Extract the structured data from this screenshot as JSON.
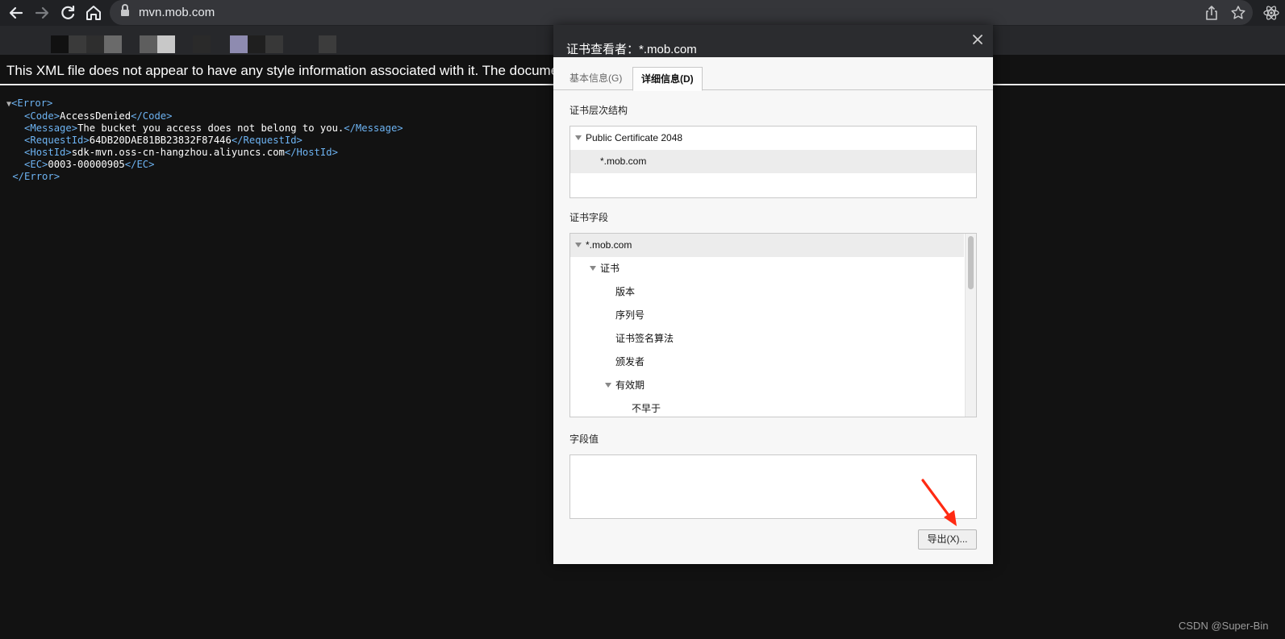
{
  "browser": {
    "url": "mvn.mob.com",
    "nav": [
      "back-icon",
      "forward-icon",
      "reload-icon",
      "home-icon"
    ],
    "omnibox_icons": [
      "share-icon",
      "star-icon"
    ],
    "extension_icon": "react-icon"
  },
  "page": {
    "xml_notice": "This XML file does not appear to have any style information associated with it. The docume",
    "xml": {
      "root_open": "<Error>",
      "root_close": "</Error>",
      "lines": [
        {
          "open": "<Code>",
          "value": "AccessDenied",
          "close": "</Code>"
        },
        {
          "open": "<Message>",
          "value": "The bucket you access does not belong to you.",
          "close": "</Message>"
        },
        {
          "open": "<RequestId>",
          "value": "64DB20DAE81BB23832F87446",
          "close": "</RequestId>"
        },
        {
          "open": "<HostId>",
          "value": "sdk-mvn.oss-cn-hangzhou.aliyuncs.com",
          "close": "</HostId>"
        },
        {
          "open": "<EC>",
          "value": "0003-00000905",
          "close": "</EC>"
        }
      ]
    }
  },
  "dialog": {
    "title": "证书查看者：*.mob.com",
    "tabs": [
      {
        "label": "基本信息(G)",
        "active": false
      },
      {
        "label": "详细信息(D)",
        "active": true
      }
    ],
    "hierarchy_label": "证书层次结构",
    "hierarchy": [
      {
        "label": "Public Certificate 2048",
        "level": 0,
        "expandable": true,
        "selected": false
      },
      {
        "label": "*.mob.com",
        "level": 1,
        "expandable": false,
        "selected": true
      }
    ],
    "fields_label": "证书字段",
    "fields": [
      {
        "label": "*.mob.com",
        "level": 0,
        "expandable": true,
        "selected": true
      },
      {
        "label": "证书",
        "level": 1,
        "expandable": true,
        "selected": false
      },
      {
        "label": "版本",
        "level": 2,
        "expandable": false,
        "selected": false
      },
      {
        "label": "序列号",
        "level": 2,
        "expandable": false,
        "selected": false
      },
      {
        "label": "证书签名算法",
        "level": 2,
        "expandable": false,
        "selected": false
      },
      {
        "label": "颁发者",
        "level": 2,
        "expandable": false,
        "selected": false
      },
      {
        "label": "有效期",
        "level": 2,
        "expandable": true,
        "selected": false
      },
      {
        "label": "不早于",
        "level": 3,
        "expandable": false,
        "selected": false
      }
    ],
    "value_label": "字段值",
    "field_value": "",
    "export_label": "导出(X)..."
  },
  "watermark": "CSDN @Super-Bin",
  "colors": {
    "page_bg": "#121212",
    "xml_tag": "#6db3f2",
    "dialog_title_bg": "#2b2c2f",
    "annotation_arrow": "#ff2a12"
  }
}
